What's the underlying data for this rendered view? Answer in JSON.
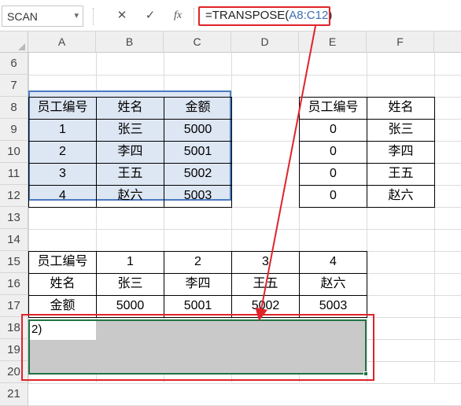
{
  "name_box": {
    "value": "SCAN"
  },
  "formula_bar": {
    "cancel_icon": "✕",
    "enter_icon": "✓",
    "fx_label": "fx",
    "formula_prefix": "=TRANSPOSE(",
    "formula_ref": "A8:C12",
    "formula_suffix": ")"
  },
  "columns": [
    "A",
    "B",
    "C",
    "D",
    "E",
    "F"
  ],
  "rows": [
    "6",
    "7",
    "8",
    "9",
    "10",
    "11",
    "12",
    "13",
    "14",
    "15",
    "16",
    "17",
    "18",
    "19",
    "20",
    "21"
  ],
  "source_table": {
    "headers": [
      "员工编号",
      "姓名",
      "金额"
    ],
    "rows": [
      [
        "1",
        "张三",
        "5000"
      ],
      [
        "2",
        "李四",
        "5001"
      ],
      [
        "3",
        "王五",
        "5002"
      ],
      [
        "4",
        "赵六",
        "5003"
      ]
    ]
  },
  "lookup_table": {
    "headers": [
      "员工编号",
      "姓名"
    ],
    "rows": [
      [
        "0",
        "张三"
      ],
      [
        "0",
        "李四"
      ],
      [
        "0",
        "王五"
      ],
      [
        "0",
        "赵六"
      ]
    ]
  },
  "transposed_table": {
    "rows": [
      [
        "员工编号",
        "1",
        "2",
        "3",
        "4"
      ],
      [
        "姓名",
        "张三",
        "李四",
        "王五",
        "赵六"
      ],
      [
        "金额",
        "5000",
        "5001",
        "5002",
        "5003"
      ]
    ]
  },
  "active_cell": {
    "value": "2)"
  },
  "colors": {
    "selection_fill": "#c9c9c9",
    "source_range_fill": "#dde6f3",
    "source_range_border": "#4a7cc0",
    "annotation_red": "#e0232a",
    "selection_green": "#217346"
  }
}
